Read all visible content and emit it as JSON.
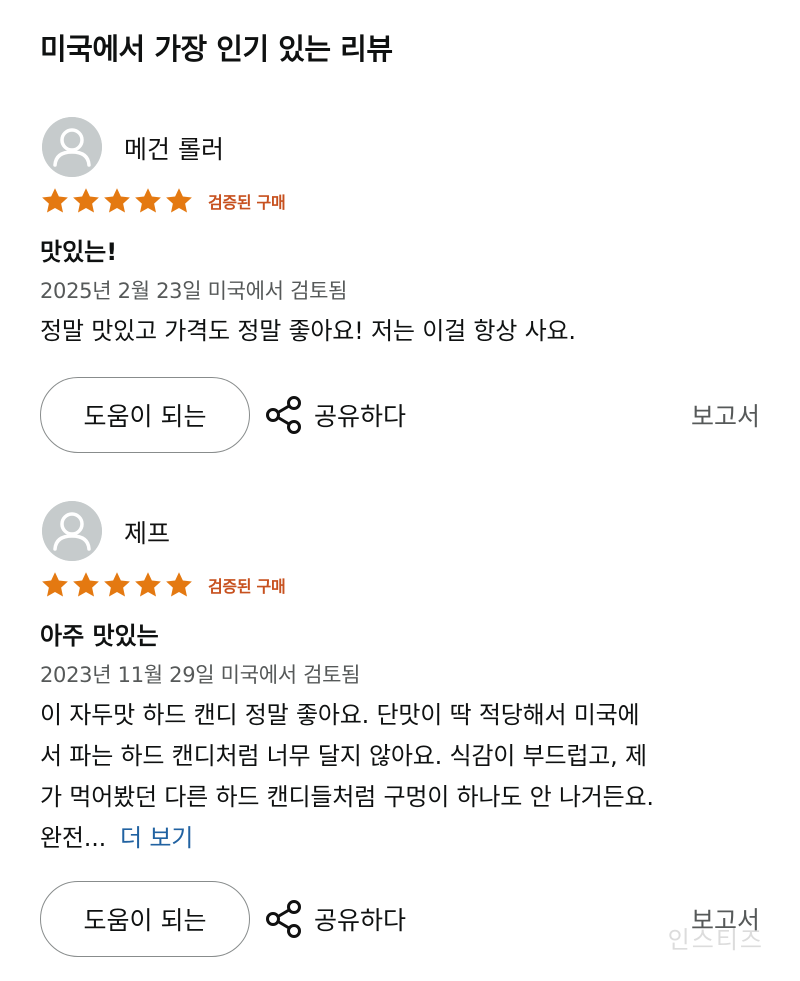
{
  "section_title": "미국에서 가장 인기 있는 리뷰",
  "colors": {
    "star": "#e47911",
    "verified": "#c7511f",
    "link": "#2162a1",
    "avatar_bg": "#c6cbcc"
  },
  "reviews": [
    {
      "reviewer": "메건 롤러",
      "rating": 5,
      "verified_label": "검증된 구매",
      "title": "맛있는!",
      "date": "2025년 2월 23일 미국에서 검토됨",
      "body": "정말 맛있고 가격도 정말 좋아요! 저는 이걸 항상 사요.",
      "see_more": "",
      "helpful_label": "도움이 되는",
      "share_label": "공유하다",
      "report_label": "보고서"
    },
    {
      "reviewer": "제프",
      "rating": 5,
      "verified_label": "검증된 구매",
      "title": "아주 맛있는",
      "date": "2023년 11월 29일 미국에서 검토됨",
      "body_lines": [
        "이 자두맛 하드 캔디 정말 좋아요. 단맛이 딱 적당해서 미국에",
        "서 파는 하드 캔디처럼 너무 달지 않아요. 식감이 부드럽고, 제",
        "가 먹어봤던 다른 하드 캔디들처럼 구멍이 하나도 안 나거든요.",
        "완전..."
      ],
      "see_more": "더 보기",
      "helpful_label": "도움이 되는",
      "share_label": "공유하다",
      "report_label": "보고서"
    }
  ],
  "watermark": "인스티즈"
}
